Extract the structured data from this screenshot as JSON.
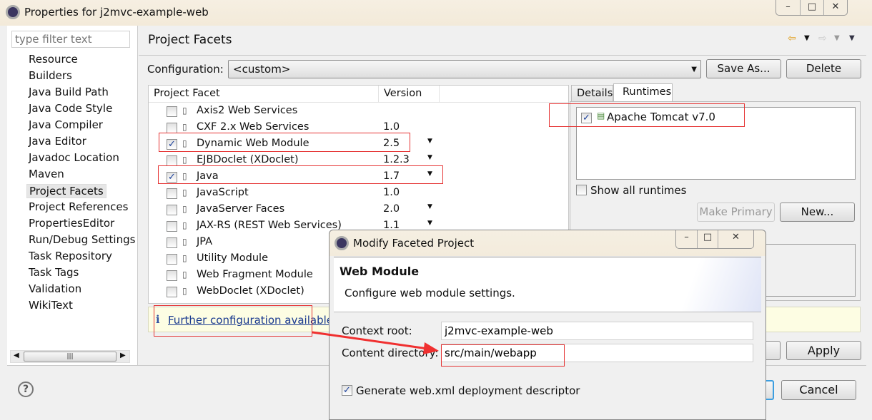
{
  "window": {
    "title": "Properties for j2mvc-example-web",
    "controls": {
      "minimize": "–",
      "maximize": "□",
      "close": "✕"
    }
  },
  "sidebar": {
    "filter_placeholder": "type filter text",
    "items": [
      "Resource",
      "Builders",
      "Java Build Path",
      "Java Code Style",
      "Java Compiler",
      "Java Editor",
      "Javadoc Location",
      "Maven",
      "Project Facets",
      "Project References",
      "PropertiesEditor",
      "Run/Debug Settings",
      "Task Repository",
      "Task Tags",
      "Validation",
      "WikiText"
    ],
    "selected": "Project Facets",
    "scroll_grip": "|||"
  },
  "page": {
    "title": "Project Facets",
    "configuration_label": "Configuration:",
    "configuration_value": "<custom>",
    "save_as": "Save As...",
    "delete": "Delete"
  },
  "facets": {
    "headers": {
      "facet": "Project Facet",
      "version": "Version"
    },
    "rows": [
      {
        "name": "Axis2 Web Services",
        "version": "",
        "checked": false,
        "dropdown": false
      },
      {
        "name": "CXF 2.x Web Services",
        "version": "1.0",
        "checked": false,
        "dropdown": false
      },
      {
        "name": "Dynamic Web Module",
        "version": "2.5",
        "checked": true,
        "dropdown": true
      },
      {
        "name": "EJBDoclet (XDoclet)",
        "version": "1.2.3",
        "checked": false,
        "dropdown": true
      },
      {
        "name": "Java",
        "version": "1.7",
        "checked": true,
        "dropdown": true
      },
      {
        "name": "JavaScript",
        "version": "1.0",
        "checked": false,
        "dropdown": false
      },
      {
        "name": "JavaServer Faces",
        "version": "2.0",
        "checked": false,
        "dropdown": true
      },
      {
        "name": "JAX-RS (REST Web Services)",
        "version": "1.1",
        "checked": false,
        "dropdown": true
      },
      {
        "name": "JPA",
        "version": "",
        "checked": false,
        "dropdown": false
      },
      {
        "name": "Utility Module",
        "version": "",
        "checked": false,
        "dropdown": false
      },
      {
        "name": "Web Fragment Module",
        "version": "",
        "checked": false,
        "dropdown": false
      },
      {
        "name": "WebDoclet (XDoclet)",
        "version": "",
        "checked": false,
        "dropdown": false
      }
    ]
  },
  "runtimes": {
    "tabs": [
      "Details",
      "Runtimes"
    ],
    "active_tab": "Runtimes",
    "items": [
      {
        "name": "Apache Tomcat v7.0",
        "checked": true
      }
    ],
    "show_all": "Show all runtimes",
    "make_primary": "Make Primary",
    "new": "New..."
  },
  "info": {
    "icon": "i",
    "link": "Further configuration available..."
  },
  "footer": {
    "apply": "Apply",
    "cancel": "Cancel",
    "help": "?"
  },
  "dialog": {
    "title": "Modify Faceted Project",
    "heading": "Web Module",
    "description": "Configure web module settings.",
    "context_root_label": "Context root:",
    "context_root": "j2mvc-example-web",
    "content_dir_label": "Content directory:",
    "content_dir": "src/main/webapp",
    "generate_label": "Generate web.xml deployment descriptor",
    "generate_checked": true
  },
  "colors": {
    "annotation": "#e53333",
    "info_bg": "#fdfde3",
    "link": "#1a3a8f"
  }
}
